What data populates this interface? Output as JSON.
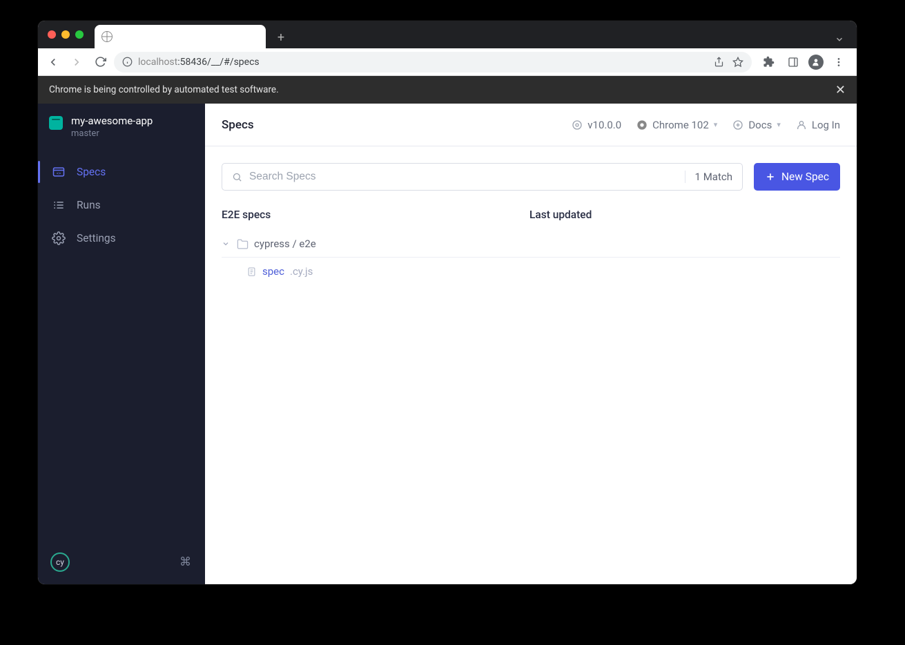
{
  "browser": {
    "url_dim1": "localhost",
    "url_mid": ":58436/__/#/specs",
    "infobar": "Chrome is being controlled by automated test software."
  },
  "sidebar": {
    "project_name": "my-awesome-app",
    "branch": "master",
    "items": [
      {
        "label": "Specs"
      },
      {
        "label": "Runs"
      },
      {
        "label": "Settings"
      }
    ],
    "logo_text": "cy"
  },
  "header": {
    "title": "Specs",
    "version": "v10.0.0",
    "browser": "Chrome 102",
    "docs": "Docs",
    "login": "Log In"
  },
  "search": {
    "placeholder": "Search Specs",
    "match": "1 Match",
    "new_spec": "New Spec"
  },
  "columns": {
    "specs": "E2E specs",
    "updated": "Last updated"
  },
  "tree": {
    "folder": "cypress / e2e",
    "spec_name": "spec",
    "spec_ext": ".cy.js"
  }
}
